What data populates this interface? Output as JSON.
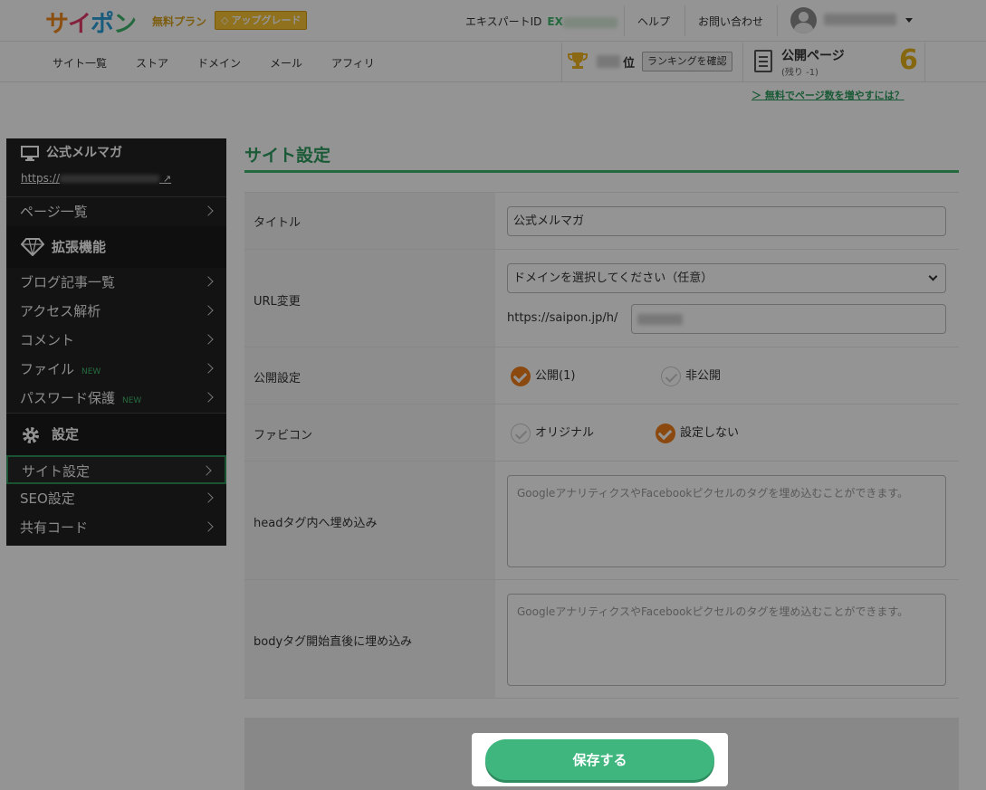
{
  "header": {
    "logo": [
      "サ",
      "イ",
      "ポ",
      "ン"
    ],
    "plan": "無料プラン",
    "upgrade_label": "アップグレード",
    "expert_label": "エキスパートID",
    "expert_prefix": "EX",
    "help": "ヘルプ",
    "contact": "お問い合わせ"
  },
  "nav": {
    "items": [
      "サイト一覧",
      "ストア",
      "ドメイン",
      "メール",
      "アフィリ"
    ],
    "rank_suffix": "位",
    "rank_button": "ランキングを確認",
    "pages_title": "公開ページ",
    "pages_sub": "(残り -1)",
    "pages_count": "6",
    "more_pages": "＞ 無料でページ数を増やすには？"
  },
  "sidebar": {
    "site_name": "公式メルマガ",
    "site_url": "https://",
    "pages_item": "ページ一覧",
    "ext_section": "拡張機能",
    "ext_items": [
      {
        "label": "ブログ記事一覧",
        "new": ""
      },
      {
        "label": "アクセス解析",
        "new": ""
      },
      {
        "label": "コメント",
        "new": ""
      },
      {
        "label": "ファイル",
        "new": "NEW"
      },
      {
        "label": "パスワード保護",
        "new": "NEW"
      }
    ],
    "settings_section": "設定",
    "settings_items": [
      "サイト設定",
      "SEO設定",
      "共有コード"
    ]
  },
  "main": {
    "title": "サイト設定",
    "title_label": "タイトル",
    "title_value": "公式メルマガ",
    "url_label": "URL変更",
    "domain_select": "ドメインを選択してください（任意）",
    "url_prefix": "https://saipon.jp/h/",
    "publish_label": "公開設定",
    "publish_public": "公開(1)",
    "publish_private": "非公開",
    "favicon_label": "ファビコン",
    "favicon_original": "オリジナル",
    "favicon_none": "設定しない",
    "head_label": "headタグ内へ埋め込み",
    "head_placeholder": "GoogleアナリティクスやFacebookピクセルのタグを埋め込むことができます。",
    "body_label": "bodyタグ開始直後に埋め込み",
    "body_placeholder": "GoogleアナリティクスやFacebookピクセルのタグを埋め込むことができます。",
    "save_button": "保存する"
  }
}
